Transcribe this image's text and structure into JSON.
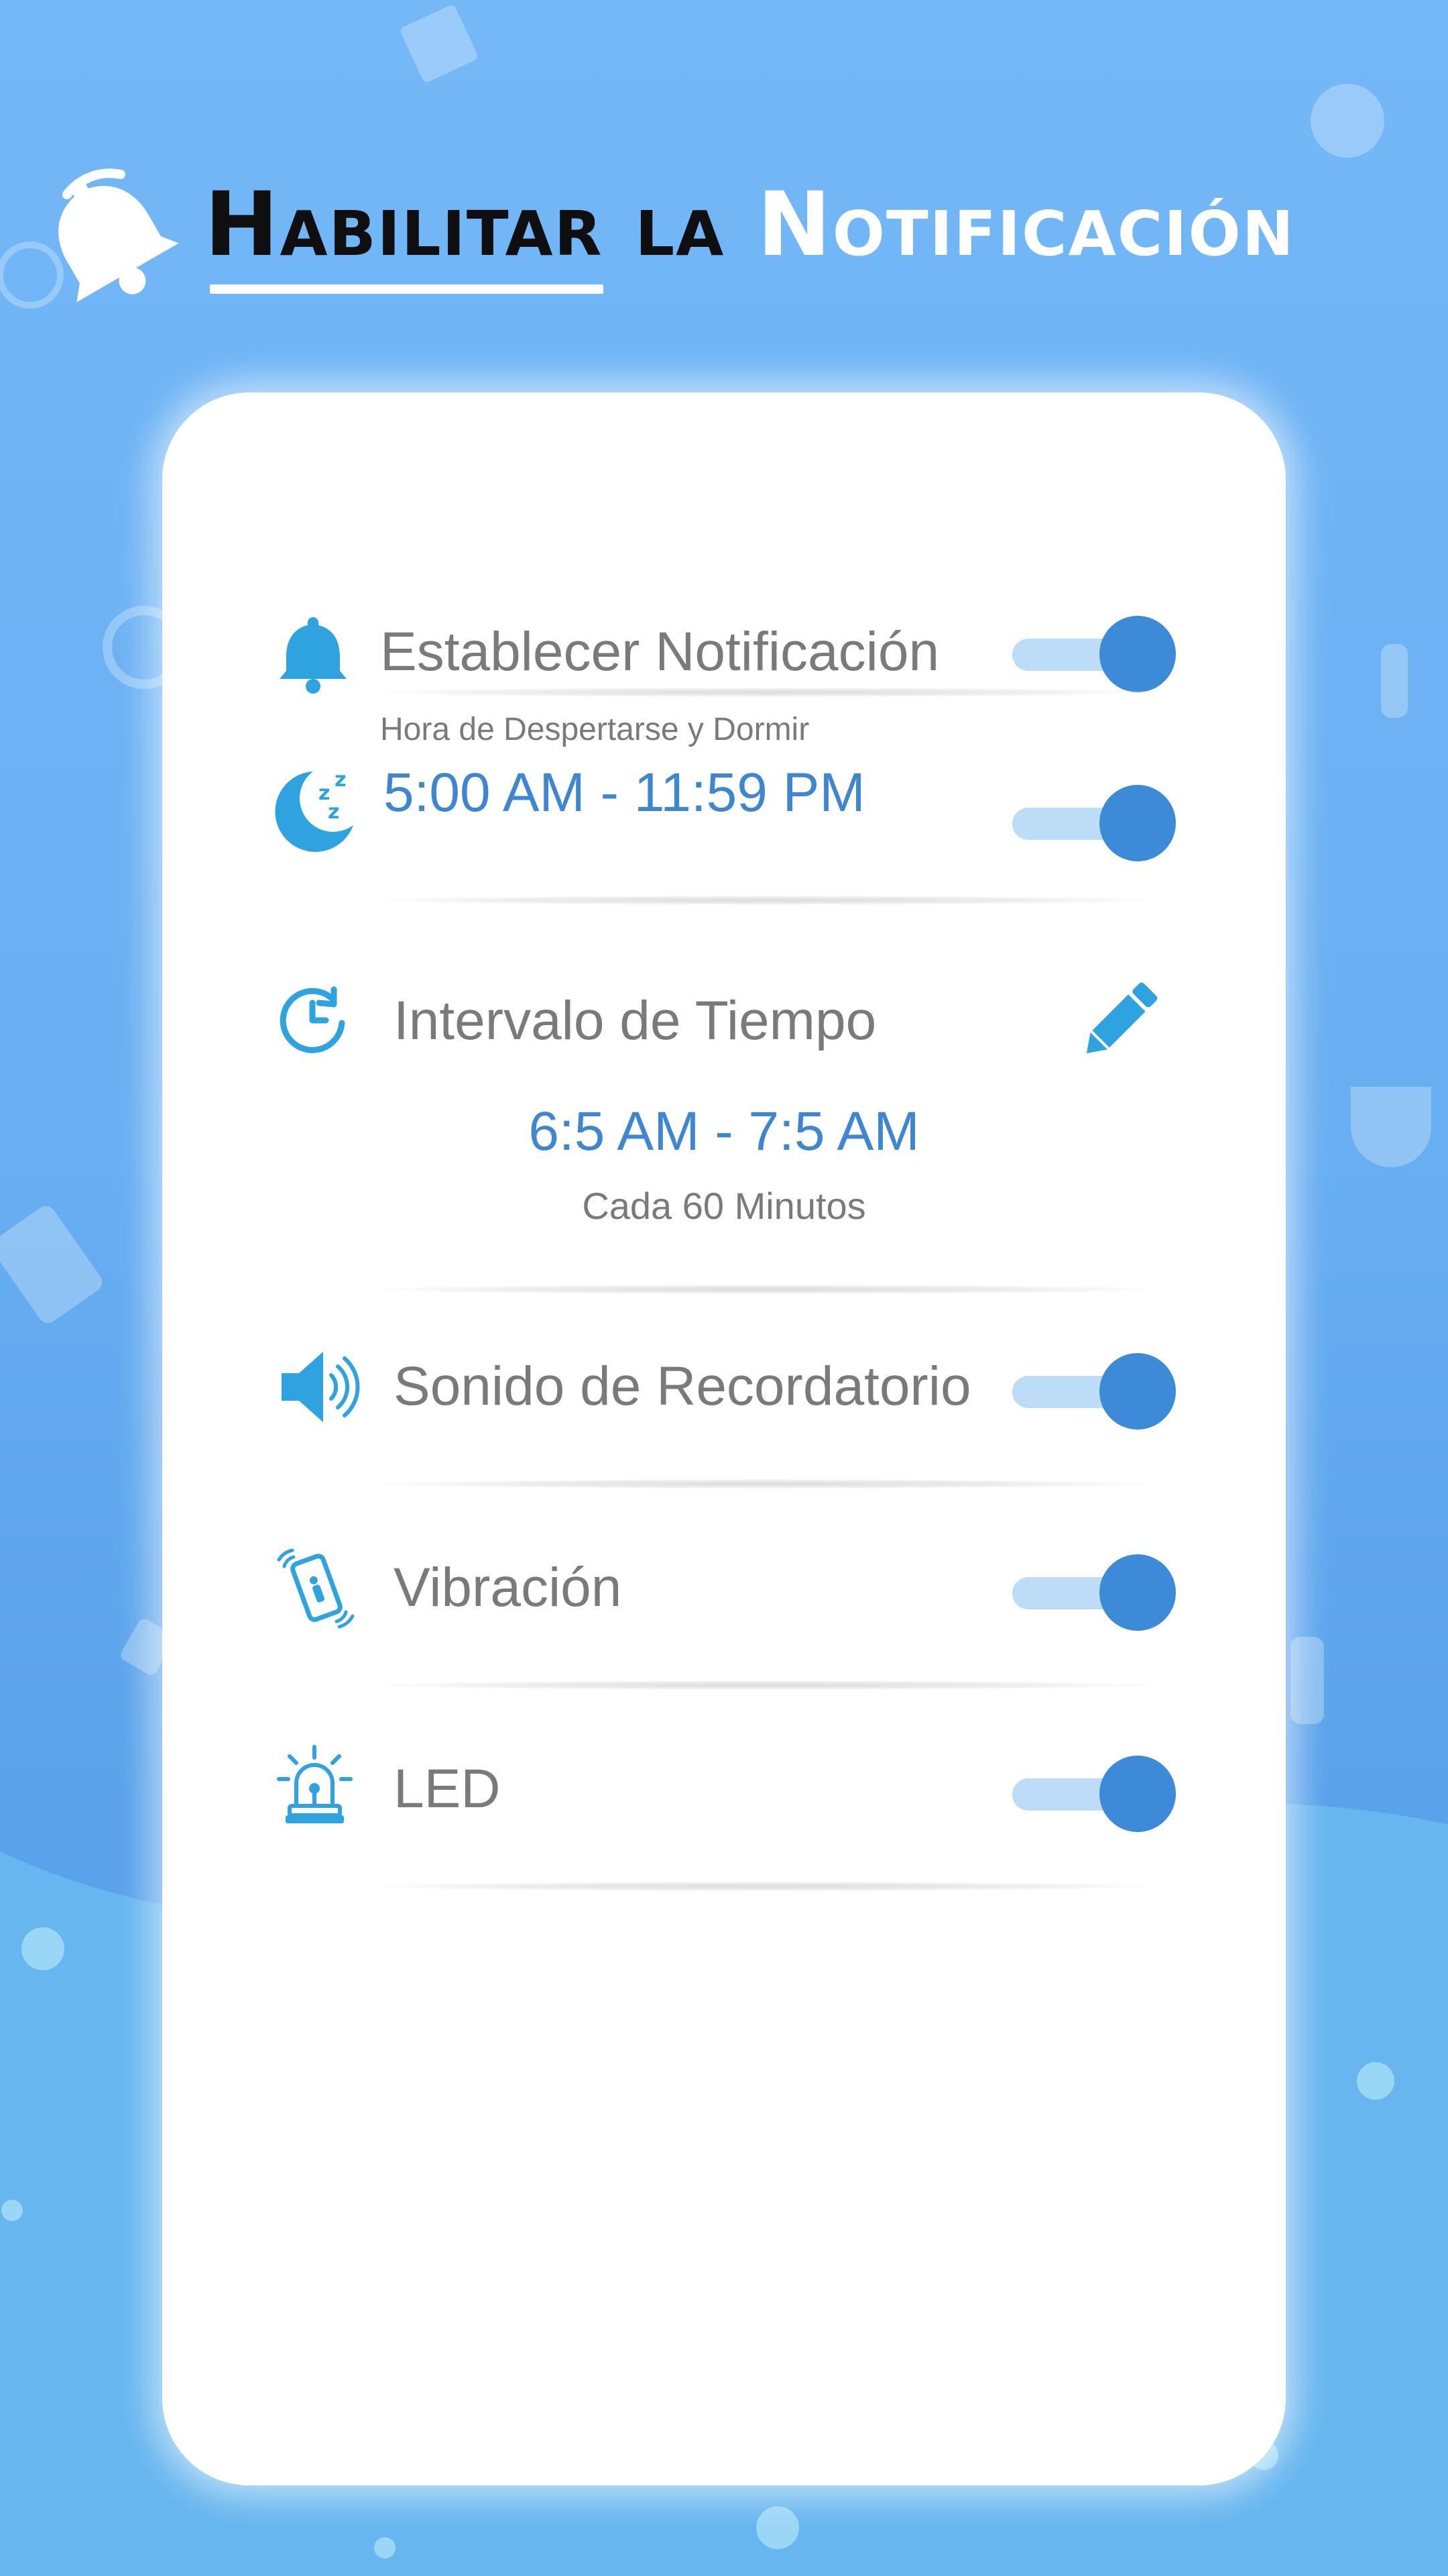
{
  "header": {
    "title_part1": "Habilitar",
    "title_part2": "la",
    "title_part3": "Notificación",
    "icon": "bell-icon"
  },
  "settings": {
    "notification": {
      "label": "Establecer Notificación",
      "icon": "bell-icon",
      "enabled": true
    },
    "sleep": {
      "caption": "Hora de Despertarse y Dormir",
      "time_range": "5:00 AM - 11:59 PM",
      "icon": "moon-sleep-icon",
      "enabled": true
    },
    "interval": {
      "label": "Intervalo de Tiempo",
      "icon": "clock-icon",
      "edit_icon": "pencil-icon",
      "time_range": "6:5 AM - 7:5 AM",
      "frequency": "Cada 60 Minutos"
    },
    "sound": {
      "label": "Sonido de Recordatorio",
      "icon": "speaker-icon",
      "enabled": true
    },
    "vibration": {
      "label": "Vibración",
      "icon": "vibrating-phone-icon",
      "enabled": true
    },
    "led": {
      "label": "LED",
      "icon": "siren-light-icon",
      "enabled": true
    }
  },
  "colors": {
    "accent": "#3c8ad8",
    "toggle_track": "#bcdcf8",
    "icon_blue": "#2fa3e0",
    "label_gray": "#7a7a7a",
    "background": "#6aaef3"
  }
}
